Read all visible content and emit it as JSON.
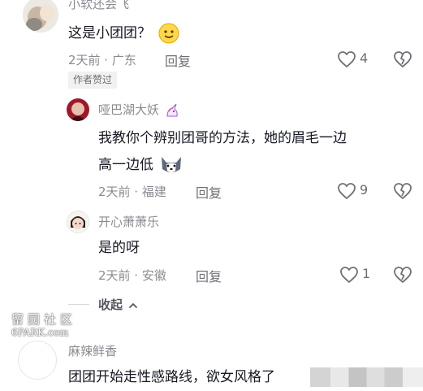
{
  "comments": [
    {
      "username": "小软还会飞",
      "text": "这是小团团？",
      "emoji": "smile-emoji",
      "meta": "2天前 · 广东",
      "reply_label": "回复",
      "likes": "4",
      "tag": "作者赞过"
    }
  ],
  "replies": [
    {
      "username": "哑巴湖大妖",
      "emoji_after_name": "unicorn-emoji",
      "text_line1": "我教你个辨别团哥的方法，她的眉毛一边",
      "text_line2": "高一边低",
      "emoji": "husky-dog-emoji",
      "meta": "2天前 · 福建",
      "reply_label": "回复",
      "likes": "9"
    },
    {
      "username": "开心萧萧乐",
      "text": "是的呀",
      "meta": "2天前 · 安徽",
      "reply_label": "回复",
      "likes": "1"
    }
  ],
  "collapse_label": "收起",
  "bottom_comment": {
    "username": "麻辣鲜香",
    "text": "团团开始走性感路线，欲女风格了"
  },
  "watermark": {
    "line1": "留园社区",
    "line2": "6PARK.com"
  },
  "colors": {
    "text_primary": "#161823",
    "text_secondary": "#8a8b91",
    "tag_bg": "#f1f1f2",
    "background": "#ffffff"
  }
}
